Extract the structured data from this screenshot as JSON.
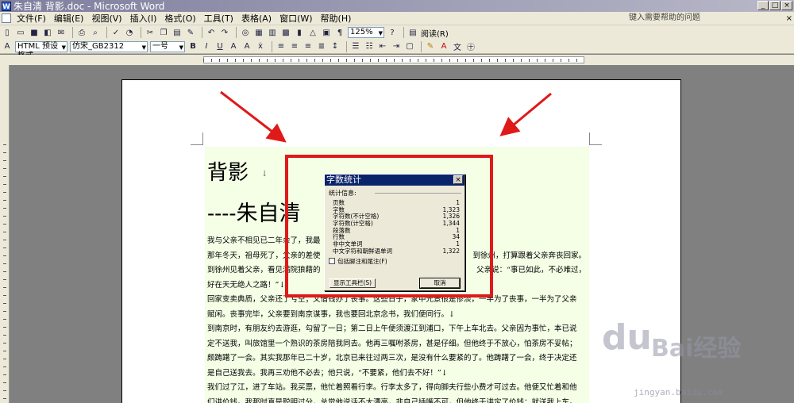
{
  "window": {
    "title": "朱自清 背影.doc - Microsoft Word",
    "min": "_",
    "max": "□",
    "close": "×"
  },
  "menu": {
    "items": [
      "文件(F)",
      "编辑(E)",
      "视图(V)",
      "插入(I)",
      "格式(O)",
      "工具(T)",
      "表格(A)",
      "窗口(W)",
      "帮助(H)"
    ],
    "help_placeholder": "键入需要帮助的问题",
    "mdi_close": "×"
  },
  "toolbar": {
    "zoom": "125%",
    "read_label": "阅读(R)",
    "style": "HTML 预设格式",
    "font": "仿宋_GB2312",
    "size": "一号",
    "bold": "B",
    "italic": "I",
    "underline": "U",
    "font_color_a": "A"
  },
  "document": {
    "title": "背影",
    "title_mark": "↓",
    "author": "----朱自清",
    "paragraphs": [
      "我与父亲不相见已二年余了，我最",
      "那年冬天，祖母死了，父亲的差使",
      "到徐州见着父亲，看见满院狼藉的",
      "好在天无绝人之路！”↓",
      "回家变卖典质，父亲还了亏空；又借钱办了丧事。这些日子，家中光景很是惨淡，一半为了丧事，一半为了父亲",
      "赋闲。丧事完毕，父亲要到南京谋事，我也要回北京念书，我们便同行。↓",
      "到南京时，有朋友约去游逛，勾留了一日；第二日上午便须渡江到浦口，下午上车北去。父亲因为事忙，本已说",
      "定不送我，叫旅馆里一个熟识的茶房陪我同去。他再三嘱咐茶房，甚是仔细。但他终于不放心，怕茶房不妥帖；",
      "颇踌躇了一会。其实我那年已二十岁，北京已来往过两三次，是没有什么要紧的了。他踌躇了一会，终于决定还",
      "是自己送我去。我再三劝他不必去；他只说，“不要紧，他们去不好！”↓",
      "我们过了江，进了车站。我买票，他忙着照看行李。行李太多了，得向脚夫行些小费才可过去。他便又忙着和他",
      "们讲价钱。我那时真是聪明过分，总觉他说话不大漂亮，非自己插嘴不可，但他终于讲定了价钱；就送我上车。"
    ],
    "right_fragments": [
      "到徐州，打算跟着父亲奔丧回家。",
      "父亲说：“事已如此，不必难过，"
    ]
  },
  "dialog": {
    "title": "字数统计",
    "close": "×",
    "group": "统计信息:",
    "stats": [
      {
        "label": "页数",
        "value": "1"
      },
      {
        "label": "字数",
        "value": "1,323"
      },
      {
        "label": "字符数(不计空格)",
        "value": "1,326"
      },
      {
        "label": "字符数(计空格)",
        "value": "1,344"
      },
      {
        "label": "段落数",
        "value": "1"
      },
      {
        "label": "行数",
        "value": "34"
      },
      {
        "label": "非中文单词",
        "value": "1"
      },
      {
        "label": "中文字符和朝鲜语单词",
        "value": "1,322"
      }
    ],
    "checkbox": "包括脚注和尾注(F)",
    "toolbar_button": "显示工具栏(S)",
    "cancel_button": "取消"
  },
  "watermark": {
    "brand": "Bai经验",
    "paw": "du",
    "url": "jingyan.baidu.com"
  },
  "colors": {
    "highlight": "#e01919",
    "dialog_title": "#0a246a",
    "body_bg": "#f4ffe6"
  }
}
